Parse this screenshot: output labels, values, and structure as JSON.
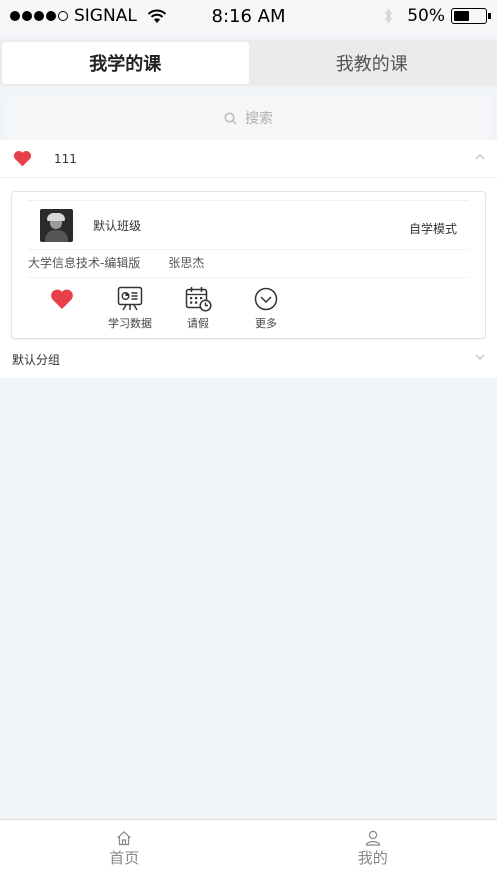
{
  "status": {
    "carrier": "SIGNAL",
    "time": "8:16 AM",
    "battery": "50%",
    "battery_level": 0.5
  },
  "tabs": [
    {
      "label": "我学的课",
      "active": true
    },
    {
      "label": "我教的课",
      "active": false
    }
  ],
  "search": {
    "placeholder": "搜索"
  },
  "group1": {
    "title": "111",
    "icon": "heart-icon",
    "expanded": true
  },
  "course": {
    "class_name": "默认班级",
    "mode": "自学模式",
    "course_name": "大学信息技术-编辑版",
    "teacher": "张思杰",
    "actions": [
      {
        "label": "",
        "icon": "heart-icon"
      },
      {
        "label": "学习数据",
        "icon": "study-data-icon"
      },
      {
        "label": "请假",
        "icon": "leave-calendar-icon"
      },
      {
        "label": "更多",
        "icon": "more-chevron-icon"
      }
    ]
  },
  "group2": {
    "title": "默认分组",
    "expanded": false
  },
  "tabbar": [
    {
      "label": "首页",
      "icon": "home-icon"
    },
    {
      "label": "我的",
      "icon": "user-icon"
    }
  ],
  "colors": {
    "heart": "#e8404a",
    "background": "#f0f3f8"
  }
}
